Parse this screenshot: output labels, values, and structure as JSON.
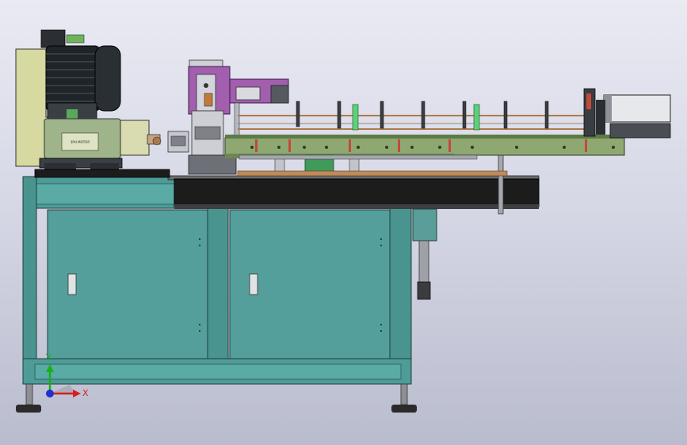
{
  "colors": {
    "frame_teal": "#4e9c98",
    "frame_teal_dark": "#2f6f6c",
    "table_black": "#1c1c1c",
    "motor_yellow": "#d6d9a0",
    "motor_black": "#1f2428",
    "gearbox_green": "#9fb48a",
    "rail_green": "#8fa872",
    "rail_green_dark": "#5e7a46",
    "press_purple": "#a15fae",
    "copper_rod": "#b07a4a",
    "axis_x": "#d42020",
    "axis_y": "#18b018",
    "axis_z": "#2030d0"
  },
  "motor": {
    "nameplate": "3PH MOTOR"
  },
  "axes": {
    "x_label": "X",
    "y_label": "Y"
  }
}
